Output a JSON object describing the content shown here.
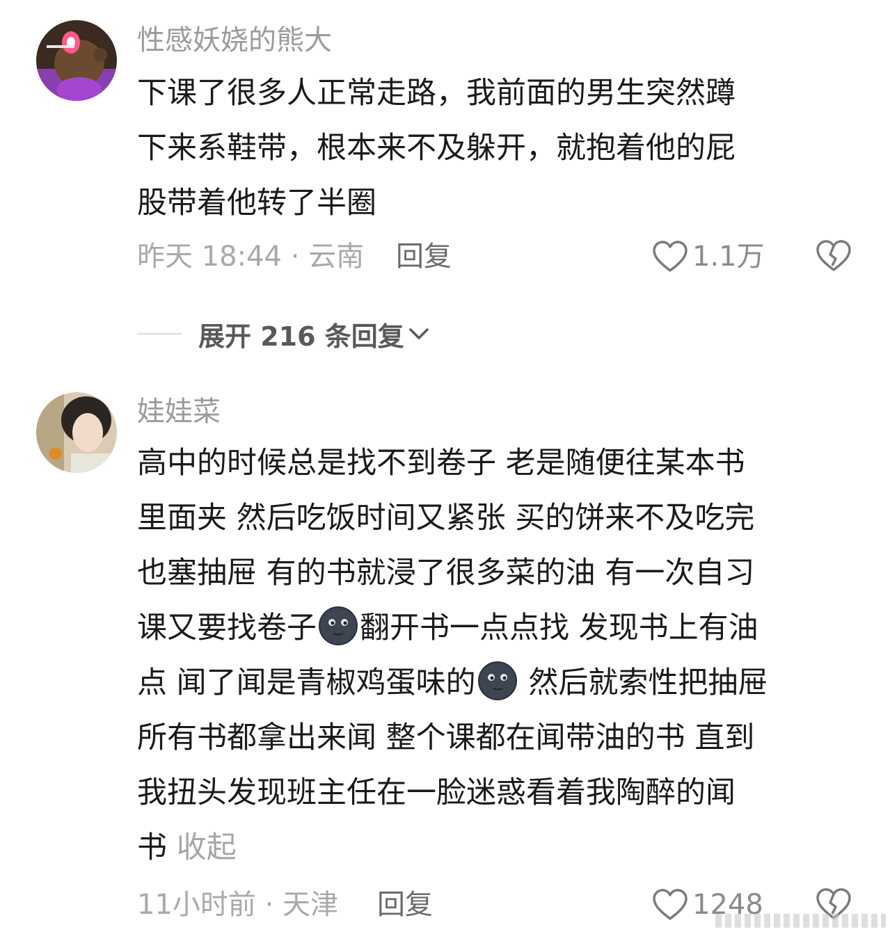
{
  "comments": [
    {
      "username": "性感妖娆的熊大",
      "lines": [
        "下课了很多人正常走路，我前面的男生突然蹲",
        "下来系鞋带，根本来不及躲开，就抱着他的屁",
        "股带着他转了半圈"
      ],
      "time_location": "昨天 18:44 · 云南",
      "reply_label": "回复",
      "like_count": "1.1万",
      "like_icon": "heart-outline-icon",
      "dislike_icon": "broken-heart-icon",
      "expand_label": "展开 216 条回复"
    },
    {
      "username": "娃娃菜",
      "line1": "高中的时候总是找不到卷子 老是随便往某本书",
      "line2": "里面夹 然后吃饭时间又紧张 买的饼来不及吃完",
      "line3": "也塞抽屉 有的书就浸了很多菜的油 有一次自习",
      "line4_a": "课又要找卷子",
      "line4_b": "翻开书一点点找 发现书上有油",
      "line5_a": "点 闻了闻是青椒鸡蛋味的",
      "line5_b": " 然后就索性把抽屉",
      "line6": "所有书都拿出来闻 整个课都在闻带油的书 直到",
      "line7": "我扭头发现班主任在一脸迷惑看着我陶醉的闻",
      "line8": "书",
      "collapse_label": "收起",
      "emoji_icon": "new-moon-face-emoji",
      "time_location": "11小时前 · 天津",
      "reply_label": "回复",
      "like_count": "1248",
      "like_icon": "heart-outline-icon",
      "dislike_icon": "broken-heart-icon"
    }
  ],
  "colors": {
    "text_primary": "#1a1a1a",
    "text_secondary": "#9b9b9b",
    "reply_text": "#6b6b6b",
    "icon_stroke": "#7a7a7a"
  }
}
